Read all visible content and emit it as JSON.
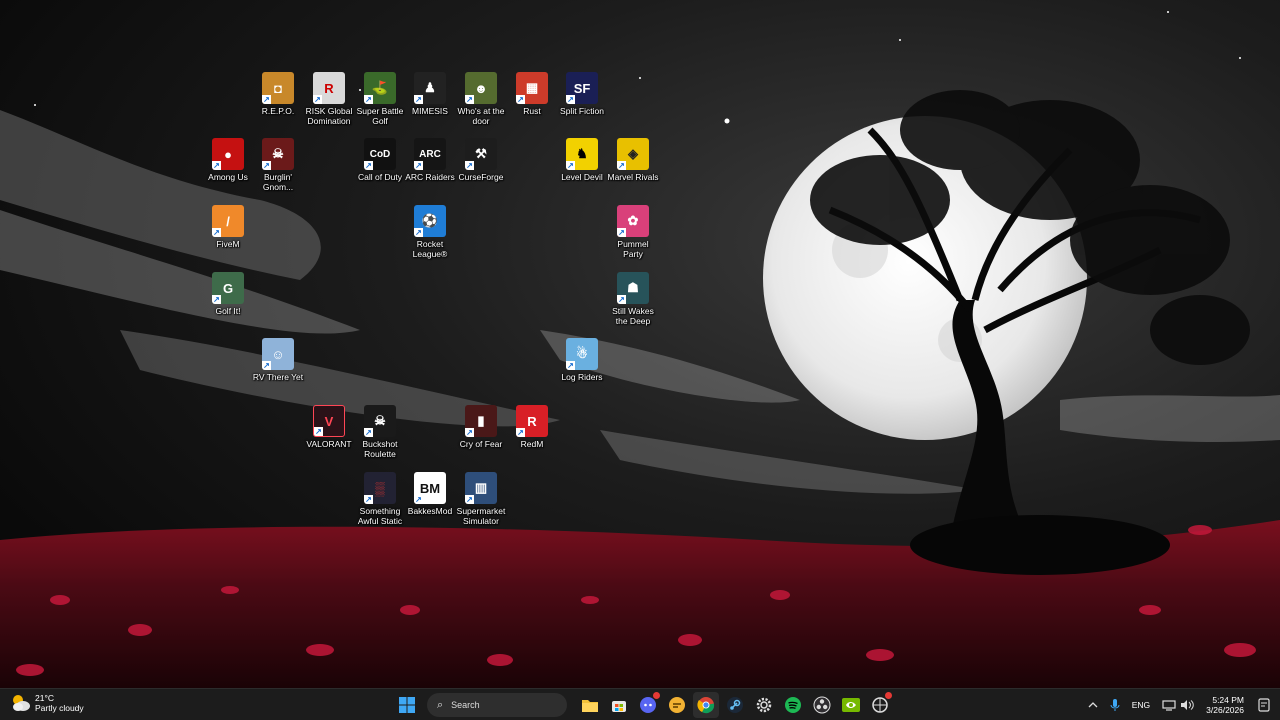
{
  "desktop_icons": [
    {
      "id": "repo",
      "label": "R.E.P.O.",
      "glyph": "◘",
      "bg": "#c8882a"
    },
    {
      "id": "risk",
      "label": "RISK Global\nDomination",
      "glyph": "R",
      "bg": "#d9d9d9"
    },
    {
      "id": "sbg",
      "label": "Super Battle\nGolf",
      "glyph": "⛳",
      "bg": "#3a6a2a"
    },
    {
      "id": "mimesis",
      "label": "MIMESIS",
      "glyph": "♟",
      "bg": "#222222"
    },
    {
      "id": "whos",
      "label": "Who's at the\ndoor",
      "glyph": "☻",
      "bg": "#556b2f"
    },
    {
      "id": "rust",
      "label": "Rust",
      "glyph": "▦",
      "bg": "#cd3b2a"
    },
    {
      "id": "split",
      "label": "Split Fiction",
      "glyph": "SF",
      "bg": "#1a1f55"
    },
    {
      "id": "among",
      "label": "Among Us",
      "glyph": "●",
      "bg": "#c51111"
    },
    {
      "id": "burglin",
      "label": "Burglin'\nGnom...",
      "glyph": "☠",
      "bg": "#6b1a1a"
    },
    {
      "id": "cod",
      "label": "Call of Duty",
      "glyph": "CoD",
      "bg": "#111111"
    },
    {
      "id": "arc",
      "label": "ARC Raiders",
      "glyph": "ARC",
      "bg": "#151515"
    },
    {
      "id": "curse",
      "label": "CurseForge",
      "glyph": "⚒",
      "bg": "#1d1d1d"
    },
    {
      "id": "level",
      "label": "Level Devil",
      "glyph": "♞",
      "bg": "#f2d100"
    },
    {
      "id": "marvel",
      "label": "Marvel Rivals",
      "glyph": "◈",
      "bg": "#e8c000"
    },
    {
      "id": "fivem",
      "label": "FiveM",
      "glyph": "/",
      "bg": "#f0892a"
    },
    {
      "id": "rocket",
      "label": "Rocket\nLeague®",
      "glyph": "⚽",
      "bg": "#1f7dd6"
    },
    {
      "id": "pummel",
      "label": "Pummel\nParty",
      "glyph": "✿",
      "bg": "#d9407a"
    },
    {
      "id": "golfit",
      "label": "Golf It!",
      "glyph": "G",
      "bg": "#3e6b4a"
    },
    {
      "id": "still",
      "label": "Still Wakes\nthe Deep",
      "glyph": "☗",
      "bg": "#27535a"
    },
    {
      "id": "rv",
      "label": "RV There Yet",
      "glyph": "☺",
      "bg": "#8fb3d9"
    },
    {
      "id": "logriders",
      "label": "Log Riders",
      "glyph": "☃",
      "bg": "#6ab0e0"
    },
    {
      "id": "valorant",
      "label": "VALORANT",
      "glyph": "V",
      "bg": "#2a1218"
    },
    {
      "id": "buckshot",
      "label": "Buckshot\nRoulette",
      "glyph": "☠",
      "bg": "#1a1a1a"
    },
    {
      "id": "cryfear",
      "label": "Cry of Fear",
      "glyph": "▮",
      "bg": "#4a1818"
    },
    {
      "id": "redm",
      "label": "RedM",
      "glyph": "R",
      "bg": "#d81f26"
    },
    {
      "id": "something",
      "label": "Something\nAwful Static",
      "glyph": "▒",
      "bg": "#222233"
    },
    {
      "id": "bakkes",
      "label": "BakkesMod",
      "glyph": "BM",
      "bg": "#ffffff"
    },
    {
      "id": "supermarket",
      "label": "Supermarket\nSimulator",
      "glyph": "▥",
      "bg": "#2e4e7a"
    }
  ],
  "taskbar": {
    "weather": {
      "temp": "21°C",
      "condition": "Partly cloudy",
      "icon": "partly-cloudy-icon"
    },
    "search": {
      "placeholder": "Search"
    },
    "pinned": [
      {
        "id": "start",
        "icon": "windows-start-icon",
        "color": "#3fa8f5"
      },
      {
        "id": "explorer",
        "icon": "folder-icon",
        "color": "#f3c13a"
      },
      {
        "id": "store",
        "icon": "store-icon",
        "color": "#ffffff"
      },
      {
        "id": "discord",
        "icon": "discord-icon",
        "color": "#5865f2",
        "badge": true
      },
      {
        "id": "chat",
        "icon": "chat-icon",
        "color": "#f2b233"
      },
      {
        "id": "chrome",
        "icon": "chrome-icon",
        "color": "#4caf50"
      },
      {
        "id": "steam",
        "icon": "steam-icon",
        "color": "#66c0f4"
      },
      {
        "id": "settings",
        "icon": "gear-icon",
        "color": "#dddddd"
      },
      {
        "id": "spotify",
        "icon": "spotify-icon",
        "color": "#1db954"
      },
      {
        "id": "obs",
        "icon": "obs-icon",
        "color": "#dddddd"
      },
      {
        "id": "nvidia",
        "icon": "nvidia-icon",
        "color": "#76b900"
      },
      {
        "id": "other",
        "icon": "app-icon",
        "color": "#dddddd",
        "badge": true
      }
    ],
    "tray": {
      "language": "ENG",
      "time": "5:24 PM",
      "date": "3/26/2026"
    }
  }
}
